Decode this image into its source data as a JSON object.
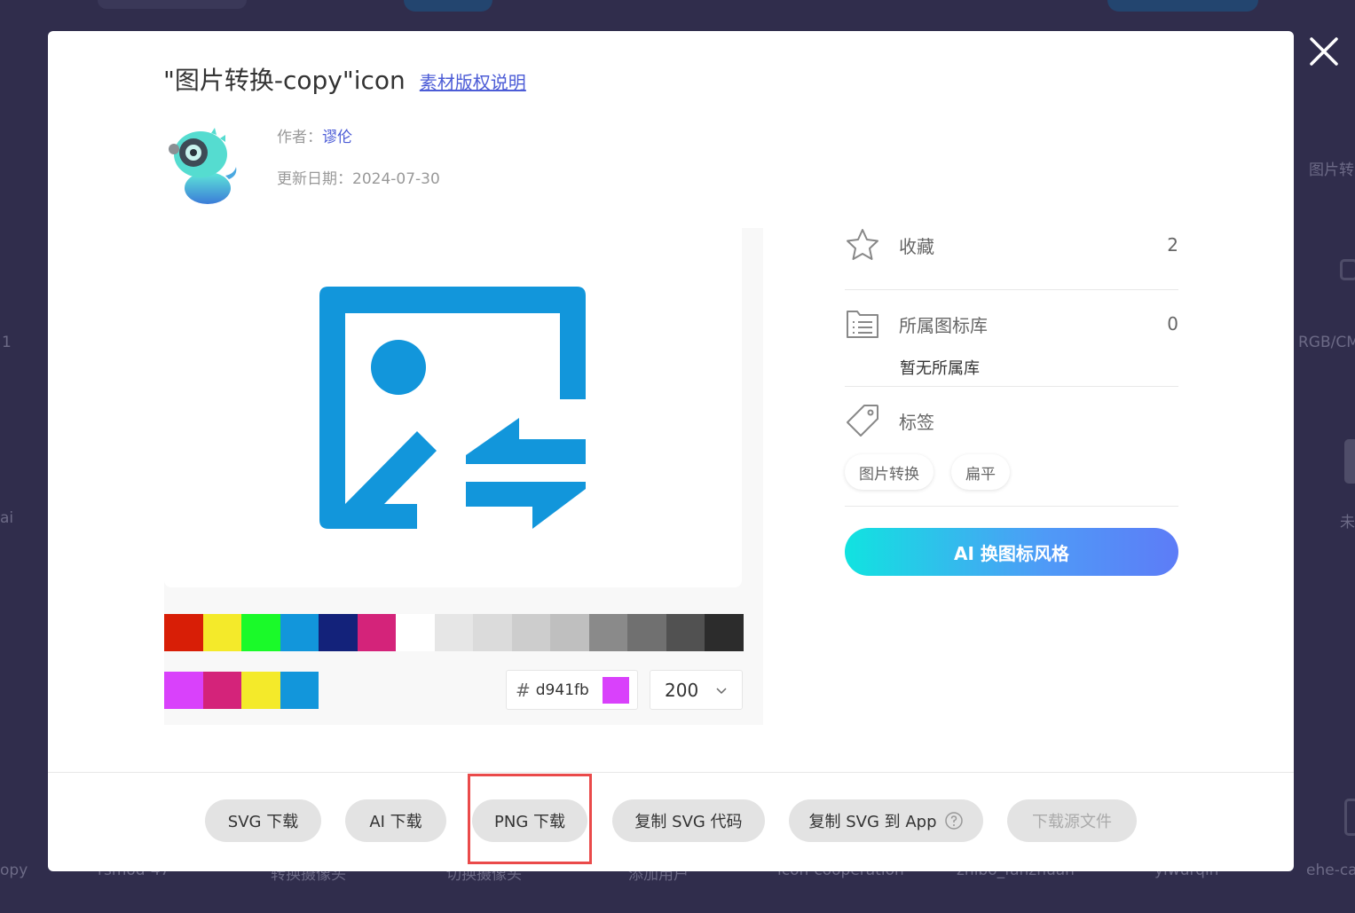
{
  "background": {
    "labels": [
      "图片转",
      "RGB/CM",
      "未",
      "1",
      "ai",
      "opy",
      "rsmod-47",
      "转换摄像头",
      "切换摄像头",
      "添加用户",
      "icon-cooperation",
      "zhibo_fanzhuan",
      "yiwurqin",
      "ehe-ca"
    ]
  },
  "modal": {
    "title": "\"图片转换-copy\"icon",
    "copyright_link": "素材版权说明",
    "author_label": "作者：",
    "author_name": "谬伦",
    "date_label": "更新日期：",
    "date": "2024-07-30",
    "icon_color": "#1296db",
    "swatches_row1": [
      "#d81e06",
      "#f4ea2a",
      "#1afa29",
      "#1296db",
      "#13227a",
      "#d4237a",
      "#ffffff",
      "#e6e6e6",
      "#dbdbdb",
      "#cdcdcd",
      "#bfbfbf",
      "#8a8a8a",
      "#707070",
      "#515151",
      "#2c2c2c"
    ],
    "swatches_row2": [
      "#d941fb",
      "#d4237a",
      "#f4ea2a",
      "#1296db"
    ],
    "hex_value": "d941fb",
    "hex_color": "#d941fb",
    "size_value": "200",
    "collect_label": "收藏",
    "collect_count": "2",
    "library_label": "所属图标库",
    "library_count": "0",
    "no_library": "暂无所属库",
    "tags_label": "标签",
    "tags": [
      "图片转换",
      "扁平"
    ],
    "ai_button": "AI 换图标风格"
  },
  "footer": {
    "svg_download": "SVG 下载",
    "ai_download": "AI 下载",
    "png_download": "PNG 下载",
    "copy_svg_code": "复制 SVG 代码",
    "copy_svg_app": "复制 SVG 到 App",
    "download_source": "下载源文件"
  }
}
